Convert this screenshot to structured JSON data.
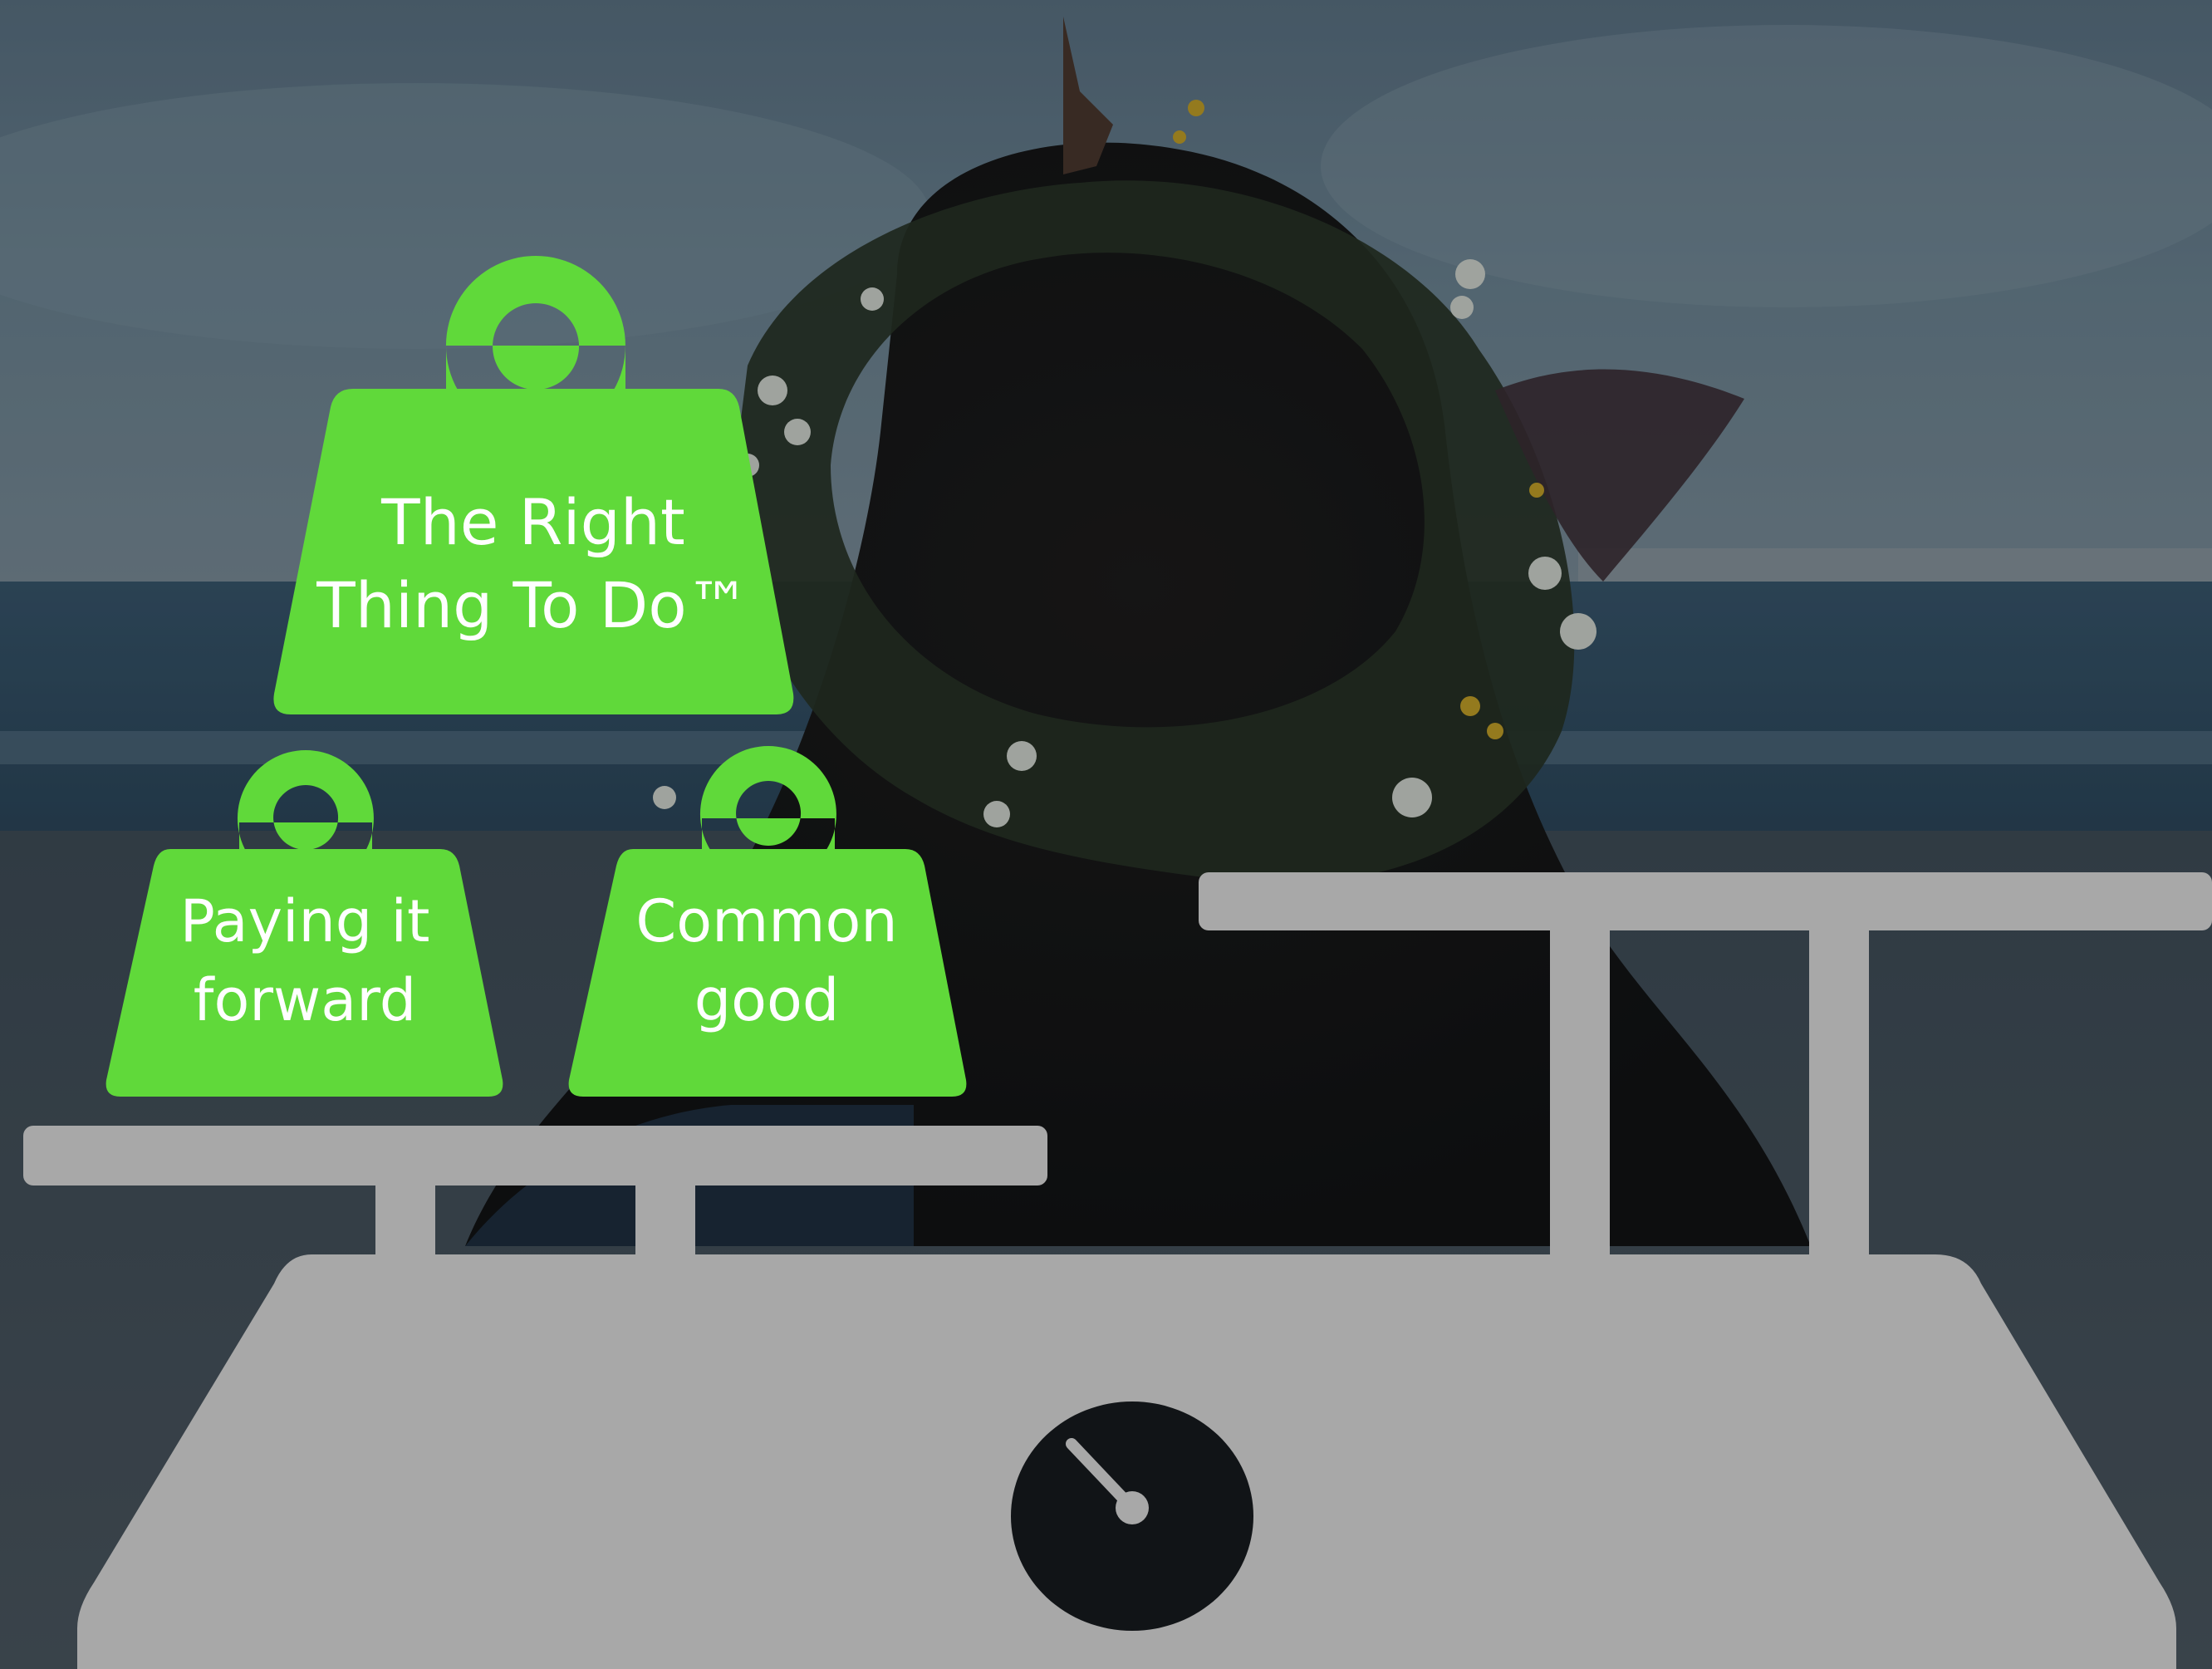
{
  "weights": {
    "big": {
      "line1": "The Right",
      "line2": "Thing To Do™"
    },
    "left": {
      "line1": "Paying it",
      "line2": "forward"
    },
    "right": {
      "line1": "Common",
      "line2": "good"
    }
  },
  "colors": {
    "weight_fill": "#60d93a",
    "scale_fill": "#a8a8a8",
    "dial_fill": "#111417",
    "dial_needle": "#a8a8a8",
    "label_text": "#ffffff"
  },
  "background_photo": {
    "scene": "person-with-flower-crown-at-beach"
  }
}
